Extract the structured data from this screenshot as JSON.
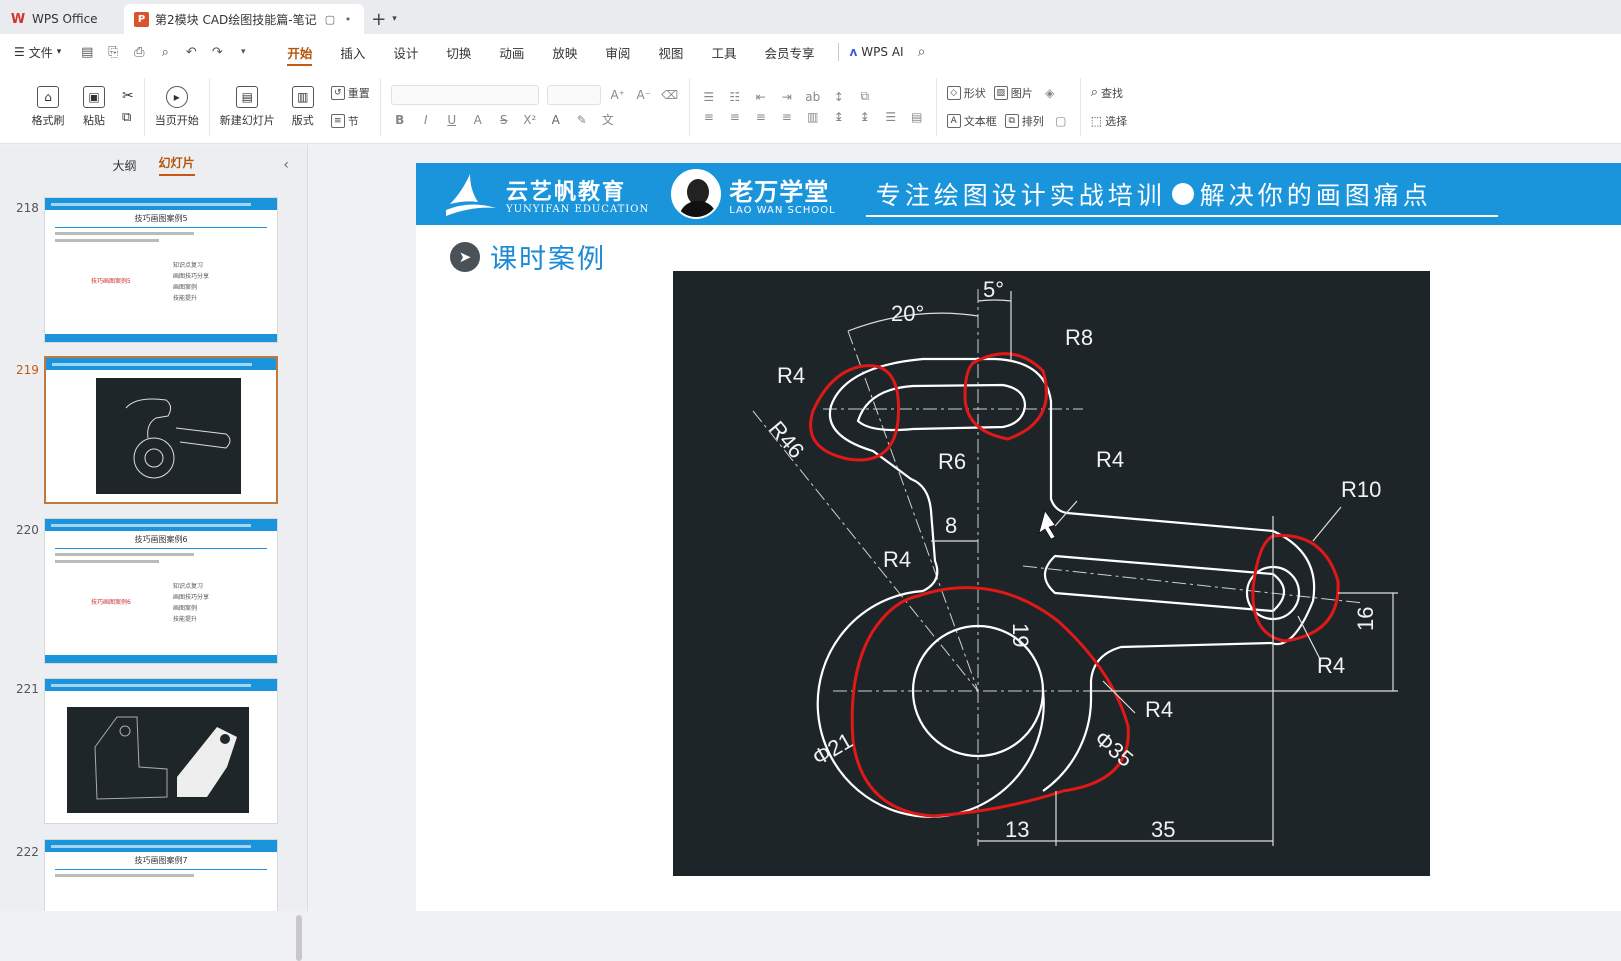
{
  "titlebar": {
    "home_tab": "WPS Office",
    "doc_tab": "第2模块 CAD绘图技能篇-笔记",
    "doc_badge": "P",
    "home_logo": "W",
    "new_tab": "+"
  },
  "menubar": {
    "file": "文件",
    "tabs": [
      "开始",
      "插入",
      "设计",
      "切换",
      "动画",
      "放映",
      "审阅",
      "视图",
      "工具",
      "会员专享"
    ],
    "active_tab": "开始",
    "wps_ai": "WPS AI"
  },
  "ribbon": {
    "format_painter": "格式刷",
    "paste": "粘贴",
    "play_from_current": "当页开始",
    "new_slide": "新建幻灯片",
    "layout": "版式",
    "reset": "重置",
    "section": "节",
    "shape": "形状",
    "picture": "图片",
    "textbox": "文本框",
    "arrange": "排列",
    "find": "查找",
    "select": "选择"
  },
  "sidebar": {
    "tabs": [
      "大纲",
      "幻灯片"
    ],
    "active_tab": "幻灯片",
    "slides": [
      {
        "num": "218",
        "title": "技巧画图案例5",
        "items": [
          "知识点复习",
          "画图技巧分享",
          "画图案例",
          "技能提升"
        ],
        "center": "技巧画图案例5"
      },
      {
        "num": "219",
        "active": true
      },
      {
        "num": "220",
        "title": "技巧画图案例6",
        "items": [
          "知识点复习",
          "画图技巧分享",
          "画图案例",
          "技能提升"
        ],
        "center": "技巧画图案例6"
      },
      {
        "num": "221"
      },
      {
        "num": "222",
        "title": "技巧画图案例7"
      }
    ]
  },
  "slide": {
    "brand1_cn": "云艺帆教育",
    "brand1_en": "YUNYIFAN EDUCATION",
    "brand2_cn": "老万学堂",
    "brand2_en": "LAO WAN SCHOOL",
    "slogan_a": "专注绘图设计实战培训",
    "slogan_b": "解决你的画图痛点",
    "section_title": "课时案例"
  },
  "drawing": {
    "dims": {
      "angle5": "5°",
      "angle20": "20°",
      "r8": "R8",
      "r4a": "R4",
      "r46": "R46",
      "r6": "R6",
      "r4b": "R4",
      "r10": "R10",
      "d8": "8",
      "r4c": "R4",
      "d19": "19",
      "d16": "16",
      "r4d": "R4",
      "r4e": "R4",
      "phi21": "Φ21",
      "phi35": "Φ35",
      "d13": "13",
      "d35": "35"
    },
    "colors": {
      "background": "#1e2529",
      "geometry": "#ffffff",
      "centerline": "#cfcfcf",
      "markup": "#e01818"
    }
  }
}
